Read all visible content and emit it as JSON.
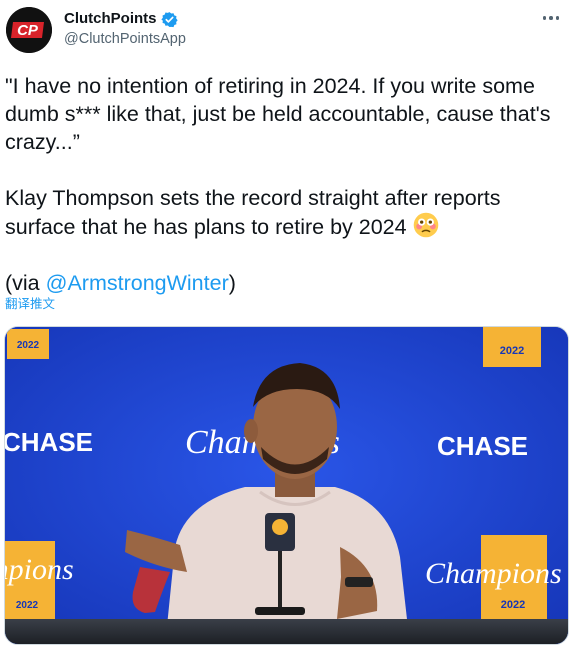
{
  "account": {
    "display_name": "ClutchPoints",
    "handle": "@ClutchPointsApp",
    "avatar_text": "CP"
  },
  "tweet": {
    "line1": "\"I have no intention of retiring in 2024. If you write some dumb s*** like that, just be held accountable, cause that's crazy...”",
    "line2": "Klay Thompson sets the record straight after reports surface that he has plans to retire by 2024",
    "via_prefix": "(via ",
    "mention": "@ArmstrongWinter",
    "via_suffix": ")",
    "translate_label": "翻译推文"
  },
  "media": {
    "backdrop_text_chase": "CHASE",
    "backdrop_text_champions": "Champions",
    "badge_year": "2022"
  },
  "colors": {
    "link": "#1d9bf0",
    "verified": "#1d9bf0",
    "backdrop_blue": "#1c3fd1",
    "badge_gold": "#f5b335"
  },
  "icons": [
    "verified-badge-icon",
    "more-options-icon",
    "flushed-face-emoji"
  ]
}
